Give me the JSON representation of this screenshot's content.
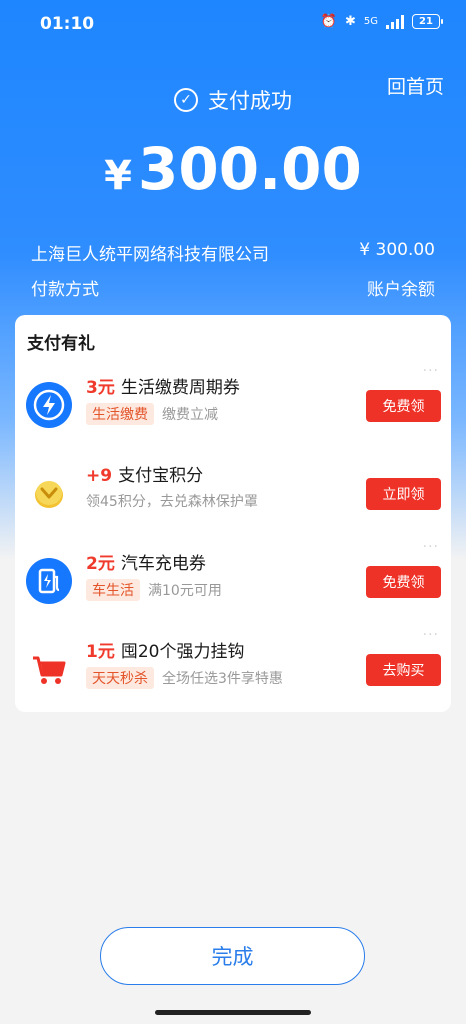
{
  "status_bar": {
    "time": "01:10",
    "network": "5G",
    "battery": "21"
  },
  "header": {
    "home_label": "回首页",
    "success_label": "支付成功",
    "currency_symbol": "¥",
    "amount": "300.00"
  },
  "payment_info": {
    "merchant": "上海巨人统平网络科技有限公司",
    "merchant_amount": "¥ 300.00",
    "method_label": "付款方式",
    "method_value": "账户余额"
  },
  "rewards": {
    "title": "支付有礼",
    "items": [
      {
        "icon": "lightning-icon",
        "num": "3元",
        "title": "生活缴费周期券",
        "tag": "生活缴费",
        "desc": "缴费立减",
        "button": "免费领"
      },
      {
        "icon": "gold-coin-icon",
        "num": "+9",
        "title": "支付宝积分",
        "tag": "",
        "desc": "领45积分，去兑森林保护罩",
        "button": "立即领"
      },
      {
        "icon": "charging-station-icon",
        "num": "2元",
        "title": "汽车充电券",
        "tag": "车生活",
        "desc": "满10元可用",
        "button": "免费领"
      },
      {
        "icon": "shopping-cart-icon",
        "num": "1元",
        "title": "囤20个强力挂钩",
        "tag": "天天秒杀",
        "desc": "全场任选3件享特惠",
        "button": "去购买"
      }
    ]
  },
  "footer": {
    "done_label": "完成"
  },
  "colors": {
    "primary": "#1e86ff",
    "accent_red": "#ef3227",
    "done_text": "#2a7dea"
  }
}
